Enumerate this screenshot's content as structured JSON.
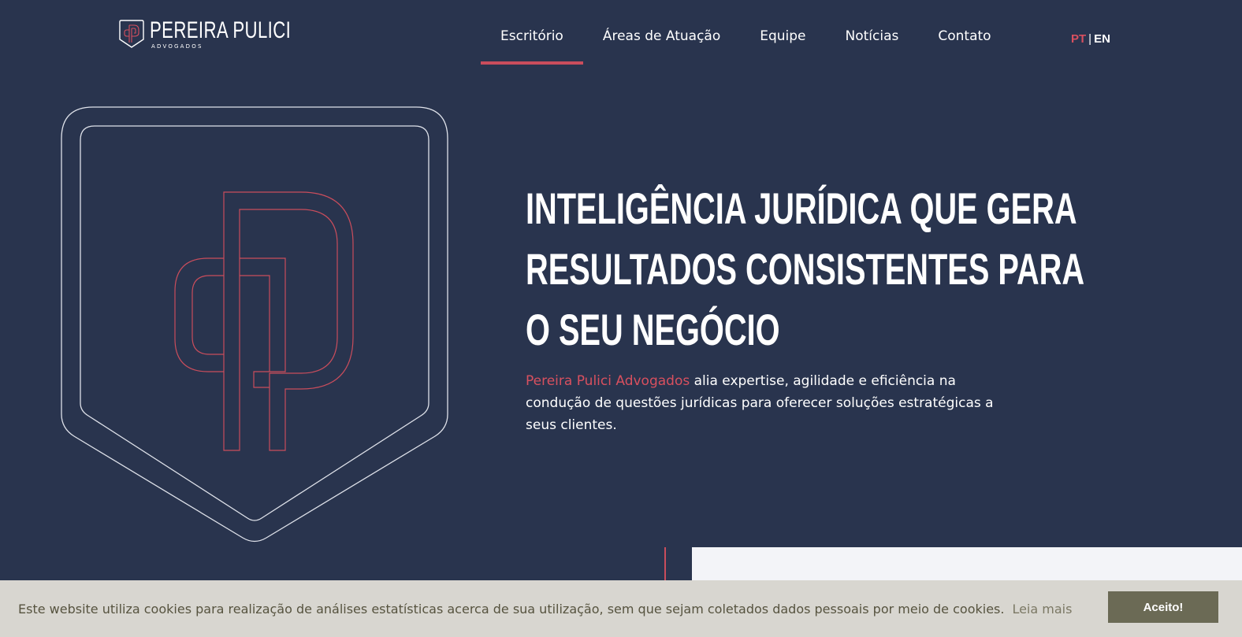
{
  "brand": {
    "name": "PEREIRA PULICI",
    "subtitle": "ADVOGADOS",
    "logo_icon": "pp-monogram-shield-icon"
  },
  "nav": {
    "items": [
      {
        "label": "Escritório",
        "active": true
      },
      {
        "label": "Áreas de Atuação",
        "active": false
      },
      {
        "label": "Equipe",
        "active": false
      },
      {
        "label": "Notícias",
        "active": false
      },
      {
        "label": "Contato",
        "active": false
      }
    ]
  },
  "language": {
    "pt": "PT",
    "separator": "|",
    "en": "EN",
    "active": "PT"
  },
  "hero": {
    "title_lines": [
      "INTELIGÊNCIA JURÍDICA QUE GERA",
      "RESULTADOS CONSISTENTES PARA",
      "O SEU NEGÓCIO"
    ],
    "brand_highlight": "Pereira Pulici Advogados",
    "description": " alia expertise, agilidade e eficiência na condução de questões jurídicas para oferecer soluções estratégicas a seus clientes.",
    "emblem_icon": "pp-monogram-shield-icon"
  },
  "cookie": {
    "text": "Este website utiliza cookies para realização de análises estatísticas acerca de sua utilização, sem que sejam coletados dados pessoais por meio de cookies.",
    "link": "Leia mais",
    "button": "Aceito!"
  },
  "colors": {
    "background": "#29344e",
    "accent": "#c94d5c",
    "cookie_bar": "#d8d6d0",
    "cookie_button": "#6b6a55"
  }
}
